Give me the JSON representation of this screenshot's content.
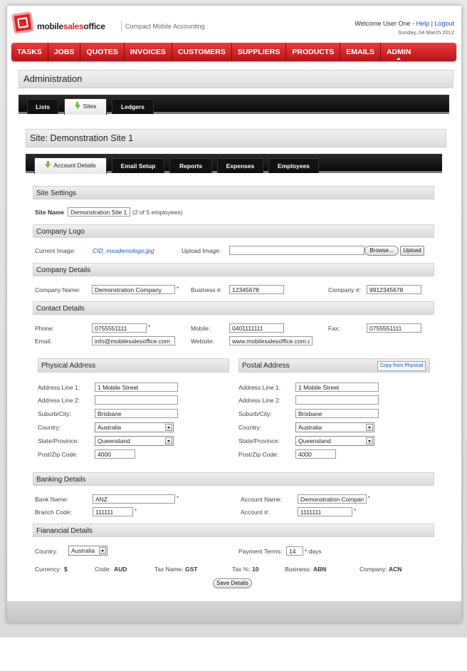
{
  "header": {
    "logo_left": "mobile",
    "logo_mid": "sales",
    "logo_right": "office",
    "tagline": "Compact Mobile Accounting",
    "welcome": "Welcome User One -",
    "help": "Help",
    "sep": "|",
    "logout": "Logout",
    "date": "Sunday, 04 March 2012"
  },
  "nav": [
    "TASKS",
    "JOBS",
    "QUOTES",
    "INVOICES",
    "CUSTOMERS",
    "SUPPLIERS",
    "PRODUCTS",
    "EMAILS",
    "ADMIN"
  ],
  "admin": {
    "title": "Administration",
    "tabs": [
      "Lists",
      "Sites",
      "Ledgers"
    ]
  },
  "site": {
    "title": "Site: Demonstration Site 1",
    "tabs": [
      "Account Details",
      "Email Setup",
      "Reports",
      "Expenses",
      "Employees"
    ]
  },
  "site_settings": {
    "heading": "Site Settings",
    "name_label": "Site Name",
    "name_value": "Demonstration Site 1",
    "employees_note": "(2 of 5 employees)"
  },
  "logo": {
    "heading": "Company Logo",
    "current_label": "Current Image:",
    "current_value": "CID_msodemologo.jpg",
    "upload_label": "Upload Image:",
    "browse": "Browse...",
    "upload": "Upload"
  },
  "company": {
    "heading": "Company Details",
    "name_label": "Company Name:",
    "name_value": "Demonstration Company",
    "business_label": "Business #:",
    "business_value": "12345678",
    "company_no_label": "Company #:",
    "company_no_value": "9912345678"
  },
  "contact": {
    "heading": "Contact Details",
    "phone_label": "Phone:",
    "phone_value": "0755551111",
    "mobile_label": "Mobile:",
    "mobile_value": "0401111111",
    "fax_label": "Fax:",
    "fax_value": "0755551111",
    "email_label": "Email:",
    "email_value": "info@mobilesalesoffice.com",
    "website_label": "Website:",
    "website_value": "www.mobilesalesoffice.com.au"
  },
  "physical": {
    "heading": "Physical Address",
    "line1_label": "Address Line 1:",
    "line1_value": "1 Mobile Street",
    "line2_label": "Address Line 2:",
    "line2_value": "",
    "suburb_label": "Suburb/City:",
    "suburb_value": "Brisbane",
    "country_label": "Country:",
    "country_value": "Australia",
    "state_label": "State/Province:",
    "state_value": "Queensland",
    "post_label": "Post/Zip Code:",
    "post_value": "4000"
  },
  "postal": {
    "heading": "Postal Address",
    "copy_button": "Copy from Physical",
    "line1_label": "Address Line 1:",
    "line1_value": "1 Mobile Street",
    "line2_label": "Address Line 2:",
    "line2_value": "",
    "suburb_label": "Suburb/City:",
    "suburb_value": "Brisbane",
    "country_label": "Country:",
    "country_value": "Australia",
    "state_label": "State/Province:",
    "state_value": "Queensland",
    "post_label": "Post/Zip Code:",
    "post_value": "4000"
  },
  "banking": {
    "heading": "Banking Details",
    "bank_label": "Bank Name:",
    "bank_value": "ANZ",
    "account_name_label": "Account Name:",
    "account_name_value": "Demonstration Company",
    "branch_label": "Branch Code:",
    "branch_value": "111111",
    "account_no_label": "Account #:",
    "account_no_value": "1111111"
  },
  "financial": {
    "heading": "Fianancial Details",
    "country_label": "Country:",
    "country_value": "Australia",
    "terms_label": "Payment Terms:",
    "terms_value": "14",
    "terms_suffix": "* days",
    "currency_label": "Currency:",
    "currency_value": "$",
    "code_label": "Code:",
    "code_value": "AUD",
    "taxname_label": "Tax Name:",
    "taxname_value": "GST",
    "taxpct_label": "Tax %:",
    "taxpct_value": "10",
    "business_label": "Business:",
    "business_value": "ABN",
    "company_label": "Company:",
    "company_value": "ACN"
  },
  "save_button": "Save Details",
  "required_mark": "*"
}
